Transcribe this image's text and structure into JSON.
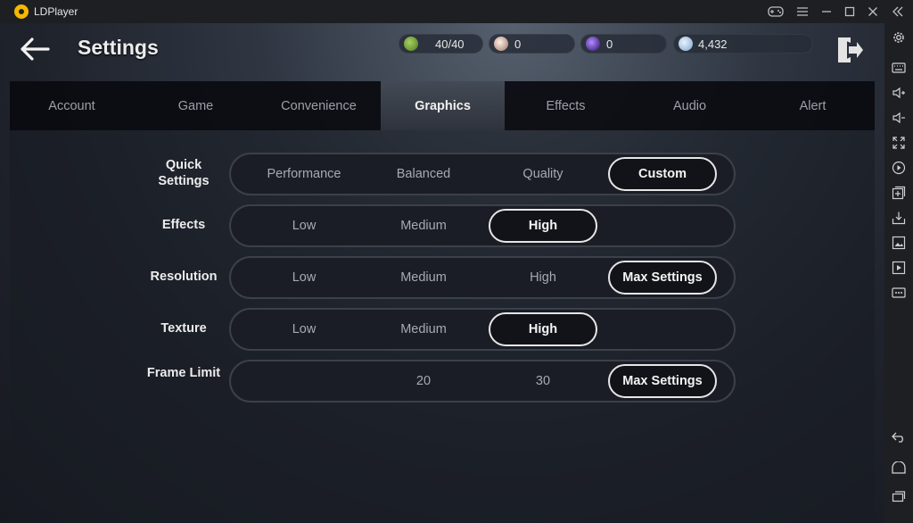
{
  "titlebar": {
    "app_name": "LDPlayer",
    "buttons": [
      "gamepad-icon",
      "menu-icon",
      "minimize-icon",
      "maximize-icon",
      "close-icon",
      "collapse-icon"
    ]
  },
  "header": {
    "title": "Settings",
    "resources": [
      {
        "name": "stamina",
        "value": "40/40",
        "color": "#6fa03a"
      },
      {
        "name": "pearl",
        "value": "0",
        "color": "#d9b8a8"
      },
      {
        "name": "dark-orb",
        "value": "0",
        "color": "#6b3bd0"
      },
      {
        "name": "silver",
        "value": "4,432",
        "color": "#bcd6ee"
      }
    ]
  },
  "tabs": [
    {
      "label": "Account",
      "active": false
    },
    {
      "label": "Game",
      "active": false
    },
    {
      "label": "Convenience",
      "active": false
    },
    {
      "label": "Graphics",
      "active": true
    },
    {
      "label": "Effects",
      "active": false
    },
    {
      "label": "Audio",
      "active": false
    },
    {
      "label": "Alert",
      "active": false
    }
  ],
  "rows": [
    {
      "label": "Quick Settings",
      "options": [
        "Performance",
        "Balanced",
        "Quality",
        "Custom"
      ],
      "selected": "Custom"
    },
    {
      "label": "Effects",
      "options": [
        "Low",
        "Medium",
        "High"
      ],
      "selected": "High"
    },
    {
      "label": "Resolution",
      "options": [
        "Low",
        "Medium",
        "High",
        "Max Settings"
      ],
      "selected": "Max Settings"
    },
    {
      "label": "Texture",
      "options": [
        "Low",
        "Medium",
        "High"
      ],
      "selected": "High"
    },
    {
      "label": "Frame Limit",
      "options": [
        "",
        "20",
        "30",
        "Max Settings"
      ],
      "selected": "Max Settings"
    }
  ],
  "sidebar_icons": [
    "settings-icon",
    "keyboard-icon",
    "volume-up-icon",
    "volume-down-icon",
    "fullscreen-icon",
    "record-icon",
    "add-app-icon",
    "install-apk-icon",
    "screenshot-icon",
    "video-icon",
    "more-icon",
    "back-icon",
    "home-icon",
    "recent-apps-icon"
  ],
  "colors": {
    "accent_logo": "#f5b800",
    "selected_border": "#e6e6e6"
  }
}
